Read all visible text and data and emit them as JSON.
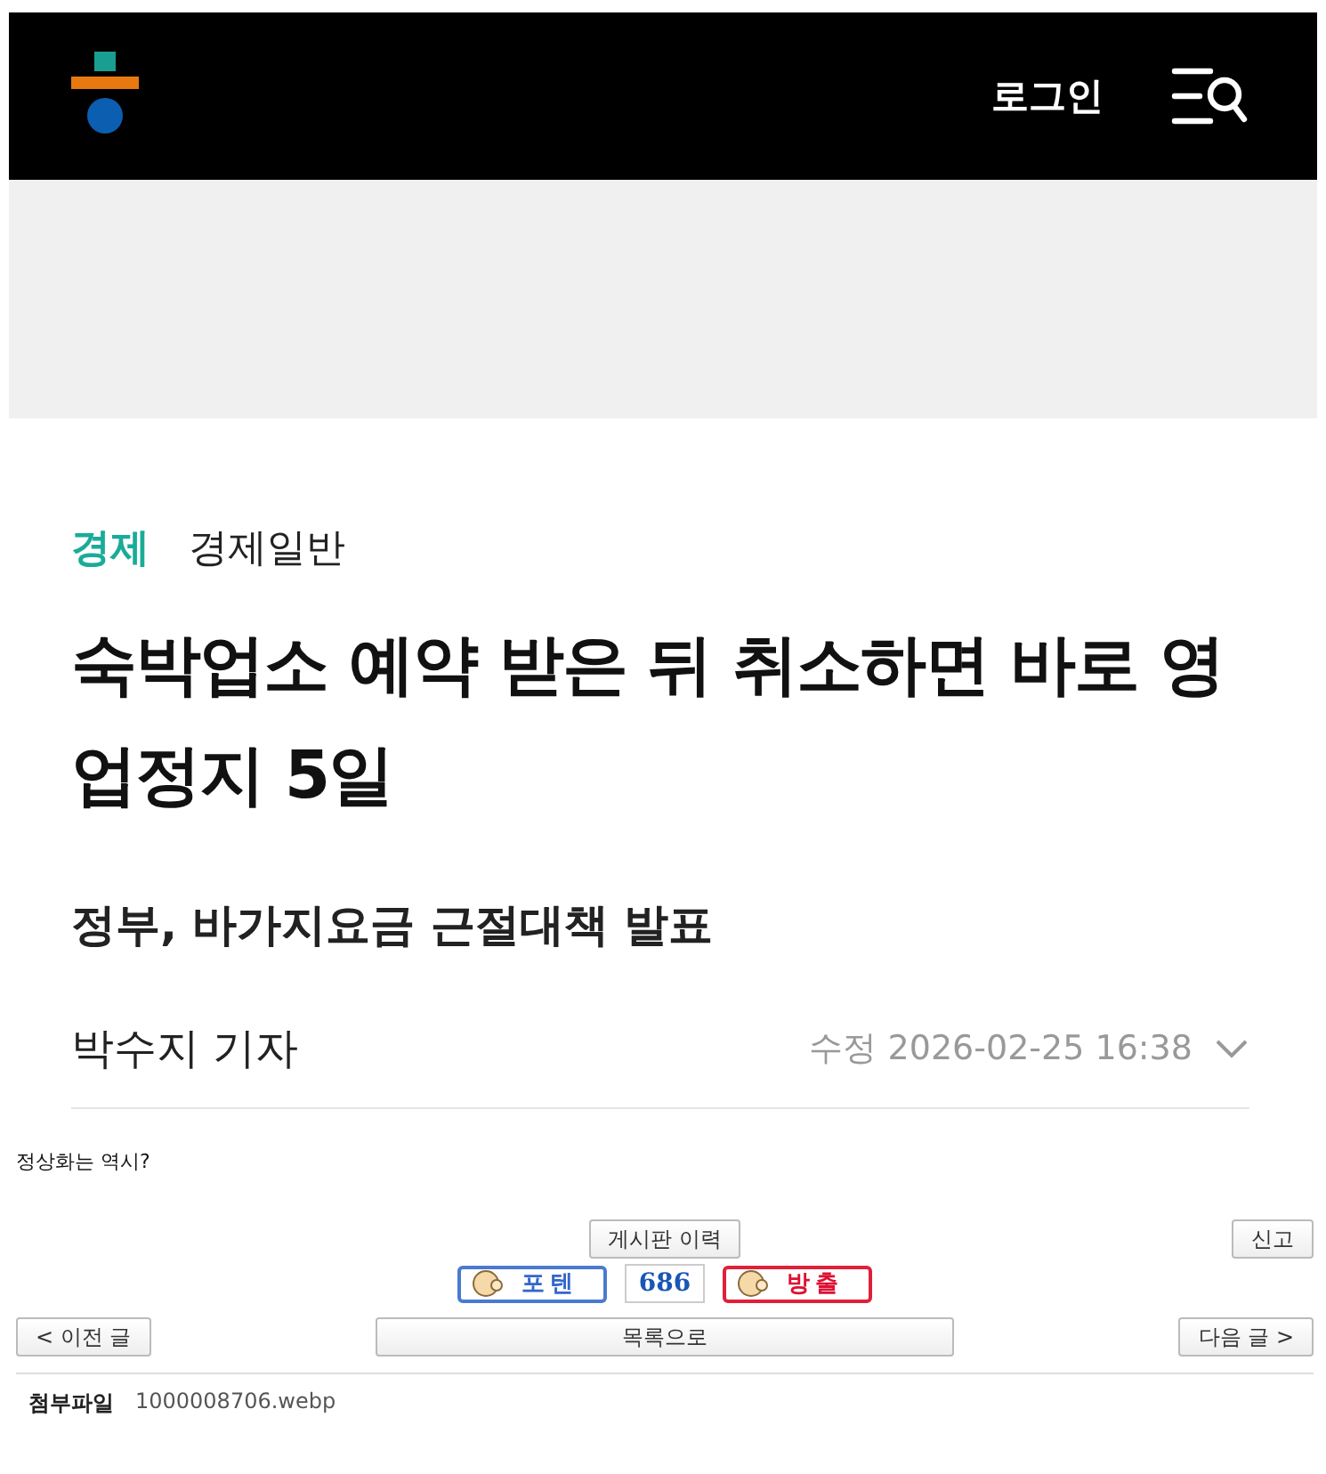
{
  "embedded_page": {
    "header": {
      "login": "로그인"
    },
    "category": {
      "section": "경제",
      "subsection": "경제일반"
    },
    "headline": "숙박업소 예약 받은 뒤 취소하면 바로 영업정지 5일",
    "subheadline": "정부, 바가지요금 근절대책 발표",
    "byline": {
      "author": "박수지 기자",
      "updated": "수정 2026-02-25 16:38"
    }
  },
  "post": {
    "body": "정상화는 역시?",
    "buttons": {
      "history": "게시판 이력",
      "report": "신고"
    },
    "votes": {
      "up": "포텐",
      "count": "686",
      "down": "방출"
    },
    "nav": {
      "prev": "< 이전 글",
      "list": "목록으로",
      "next": "다음 글 >"
    },
    "attachment": {
      "label": "첨부파일",
      "file": "1000008706.webp"
    }
  }
}
